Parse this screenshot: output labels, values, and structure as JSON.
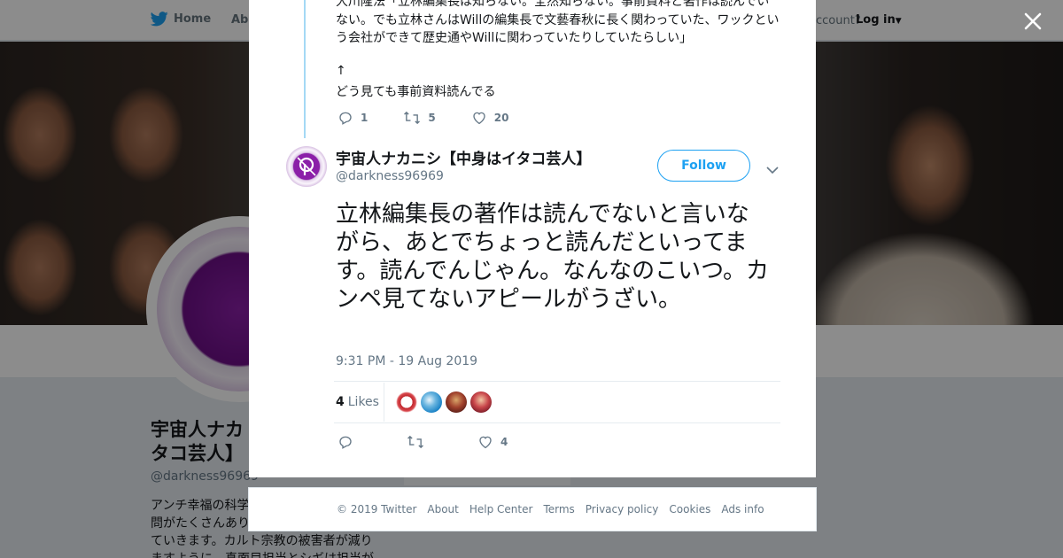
{
  "nav": {
    "home_label": "Home",
    "about_label": "Abo",
    "account_text": "ccount?",
    "login_label": "Log in"
  },
  "background_profile": {
    "name": "宇宙人ナカ…タコ芸人】",
    "name_line1": "宇宙人ナカ",
    "name_line2": "タコ芸人】",
    "handle": "@darkness96969",
    "bio_lines": [
      "アンチ幸福の科学",
      "問がたくさんあり",
      "ていきます。カルト宗教の被害者が減り",
      "ますように。真面目担当とシギは担当が"
    ],
    "card_label": "Ads info"
  },
  "previous_tweet": {
    "lines": [
      "大川隆法「立林編集長は知らない。全然知らない。事前資料と著作は読んでい",
      "ない。でも立林さんはWillの編集長で文藝春秋に長く関わっていた、ワックとい",
      "う会社ができて歴史通やWillに関わっていたりしていたらしい」"
    ],
    "arrow": "↑",
    "last_line": "どう見ても事前資料読んでる",
    "replies": "1",
    "retweets": "5",
    "likes": "20"
  },
  "tweet": {
    "author_name": "宇宙人ナカニシ【中身はイタコ芸人】",
    "author_handle": "@darkness96969",
    "follow_label": "Follow",
    "text": "立林編集長の著作は読んでないと言いながら、あとでちょっと読んだといってます。読んでんじゃん。なんなのこいつ。カンペ見てないアピールがうざい。",
    "timestamp": "9:31 PM - 19 Aug 2019",
    "likes_count": "4",
    "likes_label": "Likes",
    "action_likes": "4"
  },
  "footer": {
    "copyright": "© 2019 Twitter",
    "links": [
      "About",
      "Help Center",
      "Terms",
      "Privacy policy",
      "Cookies",
      "Ads info"
    ]
  },
  "colors": {
    "brand": "#1da1f2",
    "thread_line": "#a4d9f5",
    "muted_text": "#657786"
  }
}
